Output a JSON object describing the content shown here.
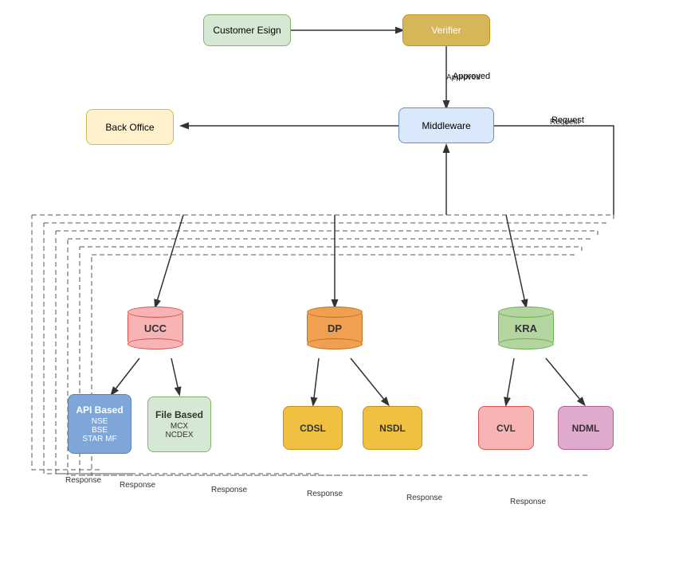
{
  "nodes": {
    "customer_esign": {
      "label": "Customer Esign"
    },
    "verifier": {
      "label": "Verifier"
    },
    "middleware": {
      "label": "Middleware"
    },
    "back_office": {
      "label": "Back Office"
    },
    "ucc": {
      "label": "UCC"
    },
    "dp": {
      "label": "DP"
    },
    "kra": {
      "label": "KRA"
    },
    "api_based": {
      "label": "API Based",
      "sub": "NSE\nBSE\nSTAR MF"
    },
    "file_based": {
      "label": "File Based",
      "sub": "MCX\nNCDEX"
    },
    "cdsl": {
      "label": "CDSL"
    },
    "nsdl": {
      "label": "NSDL"
    },
    "cvl": {
      "label": "CVL"
    },
    "ndml": {
      "label": "NDML"
    }
  },
  "labels": {
    "approved": "Approved",
    "request": "Request",
    "response1": "Response",
    "response2": "Response",
    "response3": "Response",
    "response4": "Response",
    "response5": "Response",
    "response6": "Response"
  }
}
